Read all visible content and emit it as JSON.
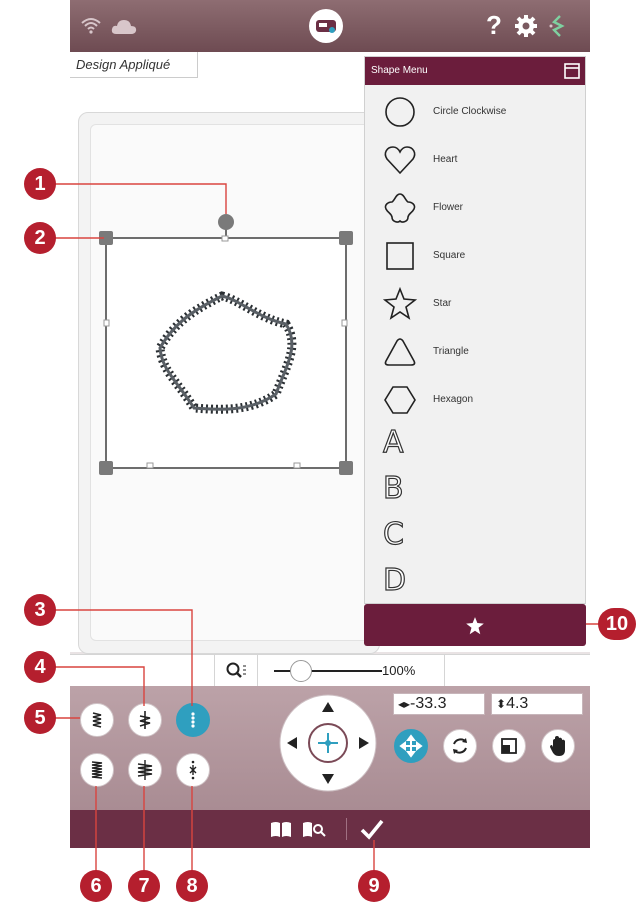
{
  "header": {
    "icons": [
      "wifi-icon",
      "cloud-icon",
      "machine-icon",
      "help-icon",
      "gear-icon",
      "embroidery-icon"
    ],
    "help_glyph": "?"
  },
  "design": {
    "title": "Design Appliqué"
  },
  "shape_menu": {
    "title": "Shape Menu",
    "items": [
      {
        "label": "Circle Clockwise",
        "icon": "circle-icon"
      },
      {
        "label": "Heart",
        "icon": "heart-icon"
      },
      {
        "label": "Flower",
        "icon": "flower-icon"
      },
      {
        "label": "Square",
        "icon": "square-icon"
      },
      {
        "label": "Star",
        "icon": "star-icon"
      },
      {
        "label": "Triangle",
        "icon": "triangle-icon"
      },
      {
        "label": "Hexagon",
        "icon": "hexagon-icon"
      }
    ],
    "letters": [
      "A",
      "B",
      "C",
      "D"
    ]
  },
  "zoom": {
    "level_label": "100%"
  },
  "position": {
    "x_value": "-33.3",
    "y_value": "4.3"
  },
  "colors": {
    "accent": "#6b1d3c",
    "active": "#2f9fbf",
    "callout": "#b51f2e"
  },
  "callouts": [
    "1",
    "2",
    "3",
    "4",
    "5",
    "6",
    "7",
    "8",
    "9",
    "10"
  ]
}
